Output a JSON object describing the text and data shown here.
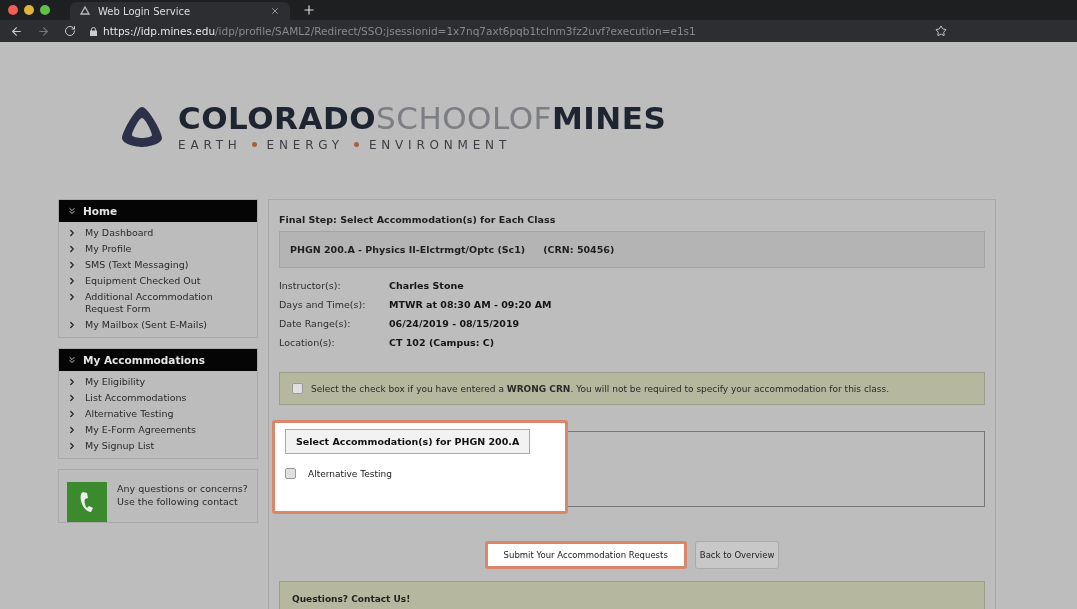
{
  "browser": {
    "tab": {
      "title": "Web Login Service",
      "selected": true
    },
    "url": {
      "host": "https://idp.mines.edu",
      "path": "/idp/profile/SAML2/Redirect/SSO;jsessionid=1x7nq7axt6pqb1tclnm3fz2uvf?execution=e1s1"
    }
  },
  "logo": {
    "name_parts": [
      {
        "text": "COLORADO",
        "emphasis": true
      },
      {
        "text": "SCHOOLOF",
        "emphasis": false
      },
      {
        "text": "MINES",
        "emphasis": true
      }
    ],
    "tagline": [
      "EARTH",
      "ENERGY",
      "ENVIRONMENT"
    ]
  },
  "sidebar": {
    "sections": [
      {
        "title": "Home",
        "expanded": true,
        "items": [
          "My Dashboard",
          "My Profile",
          "SMS (Text Messaging)",
          "Equipment Checked Out",
          "Additional Accommodation Request Form",
          "My Mailbox (Sent E-Mails)"
        ]
      },
      {
        "title": "My Accommodations",
        "expanded": true,
        "items": [
          "My Eligibility",
          "List Accommodations",
          "Alternative Testing",
          "My E-Form Agreements",
          "My Signup List"
        ]
      }
    ],
    "contact": {
      "lines": [
        "Any questions or concerns?",
        "Use the following contact"
      ]
    }
  },
  "main": {
    "heading": "Final Step: Select Accommodation(s) for Each Class",
    "class": {
      "title": "PHGN 200.A - Physics II-Elctrmgt/Optc (Sc1)",
      "crn": "(CRN: 50456)"
    },
    "details": [
      {
        "label": "Instructor(s):",
        "value": "Charles Stone"
      },
      {
        "label": "Days and Time(s):",
        "value": "MTWR at 08:30 AM - 09:20 AM"
      },
      {
        "label": "Date Range(s):",
        "value": "06/24/2019 - 08/15/2019"
      },
      {
        "label": "Location(s):",
        "value": "CT 102 (Campus: C)"
      }
    ],
    "wrong_crn": {
      "checked": false,
      "text": "Select the check box if you have entered a **WRONG CRN**. You will not be required to specify your accommodation for this class."
    },
    "accommodations": {
      "legend": "Select Accommodation(s) for PHGN 200.A",
      "highlighted": true,
      "options": [
        {
          "label": "Alternative Testing",
          "checked": false
        }
      ]
    },
    "buttons": [
      {
        "label": "Submit Your Accommodation Requests",
        "highlighted": true
      },
      {
        "label": "Back to Overview",
        "highlighted": false
      }
    ],
    "questions": {
      "title": "Questions? Contact Us!"
    }
  }
}
